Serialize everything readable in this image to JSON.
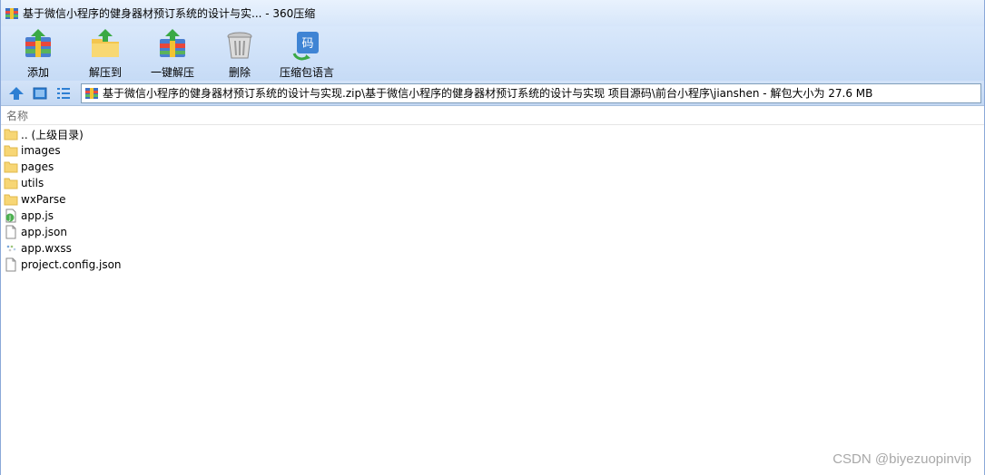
{
  "window": {
    "title": "基于微信小程序的健身器材预订系统的设计与实... - 360压缩"
  },
  "toolbar": {
    "items": [
      {
        "label": "添加",
        "icon": "add-archive-icon"
      },
      {
        "label": "解压到",
        "icon": "extract-to-icon"
      },
      {
        "label": "一键解压",
        "icon": "one-click-extract-icon"
      },
      {
        "label": "删除",
        "icon": "delete-icon"
      },
      {
        "label": "压缩包语言",
        "icon": "archive-language-icon"
      }
    ]
  },
  "addressbar": {
    "path": "基于微信小程序的健身器材预订系统的设计与实现.zip\\基于微信小程序的健身器材预订系统的设计与实现 项目源码\\前台小程序\\jianshen - 解包大小为 27.6 MB"
  },
  "list": {
    "column_name": "名称",
    "files": [
      {
        "name": ".. (上级目录)",
        "type": "folder"
      },
      {
        "name": "images",
        "type": "folder"
      },
      {
        "name": "pages",
        "type": "folder"
      },
      {
        "name": "utils",
        "type": "folder"
      },
      {
        "name": "wxParse",
        "type": "folder"
      },
      {
        "name": "app.js",
        "type": "js"
      },
      {
        "name": "app.json",
        "type": "file"
      },
      {
        "name": "app.wxss",
        "type": "wxss"
      },
      {
        "name": "project.config.json",
        "type": "file"
      }
    ]
  },
  "watermark": "CSDN @biyezuopinvip",
  "colors": {
    "titlebar": "#d6e6fa",
    "toolbar": "#c6dbf6",
    "folder": "#f7d675",
    "nav_blue": "#2d7fd3"
  }
}
